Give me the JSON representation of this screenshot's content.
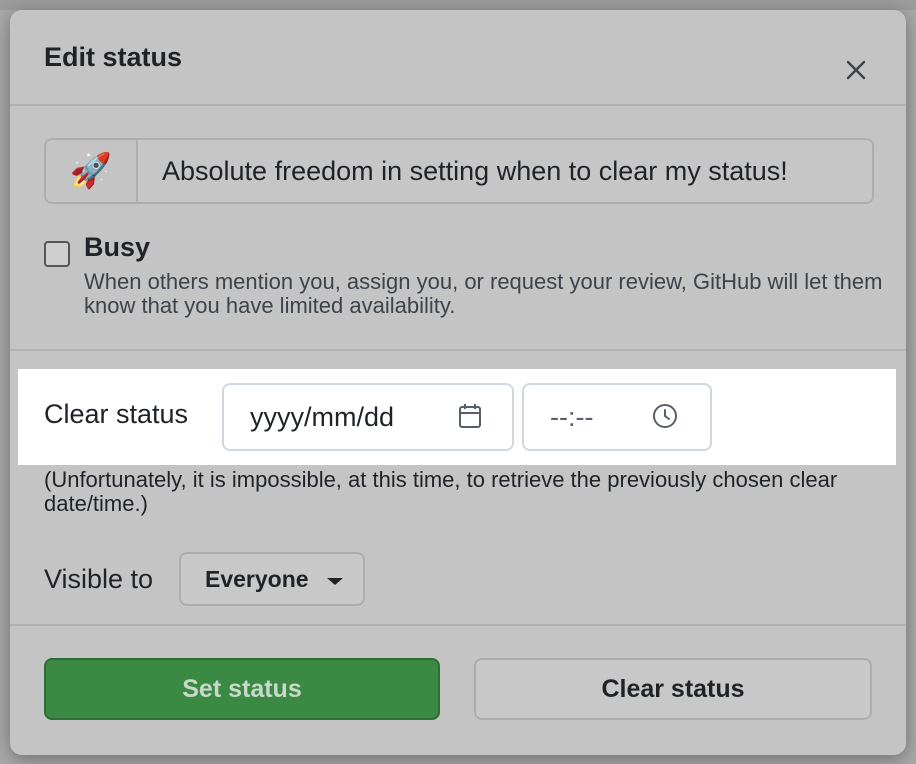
{
  "dialog": {
    "title": "Edit status"
  },
  "status": {
    "emoji": "🚀",
    "message": "Absolute freedom in setting when to clear my status!"
  },
  "busy": {
    "label": "Busy",
    "description": "When others mention you, assign you, or request your review, GitHub will let them know that you have limited availability.",
    "checked": false
  },
  "clear_status": {
    "label": "Clear status",
    "date_placeholder": "yyyy/mm/dd",
    "time_placeholder": "--:--",
    "note": "(Unfortunately, it is impossible, at this time, to retrieve the previously chosen clear date/time.)"
  },
  "visibility": {
    "label": "Visible to",
    "selected": "Everyone"
  },
  "actions": {
    "set_label": "Set status",
    "clear_label": "Clear status"
  },
  "colors": {
    "primary_button": "#3b8a43",
    "highlight": "#ffffff",
    "overlay": "#c4c4c4"
  },
  "icons": {
    "close": "close-icon",
    "calendar": "calendar-icon",
    "clock": "clock-icon",
    "caret": "caret-down-icon"
  }
}
